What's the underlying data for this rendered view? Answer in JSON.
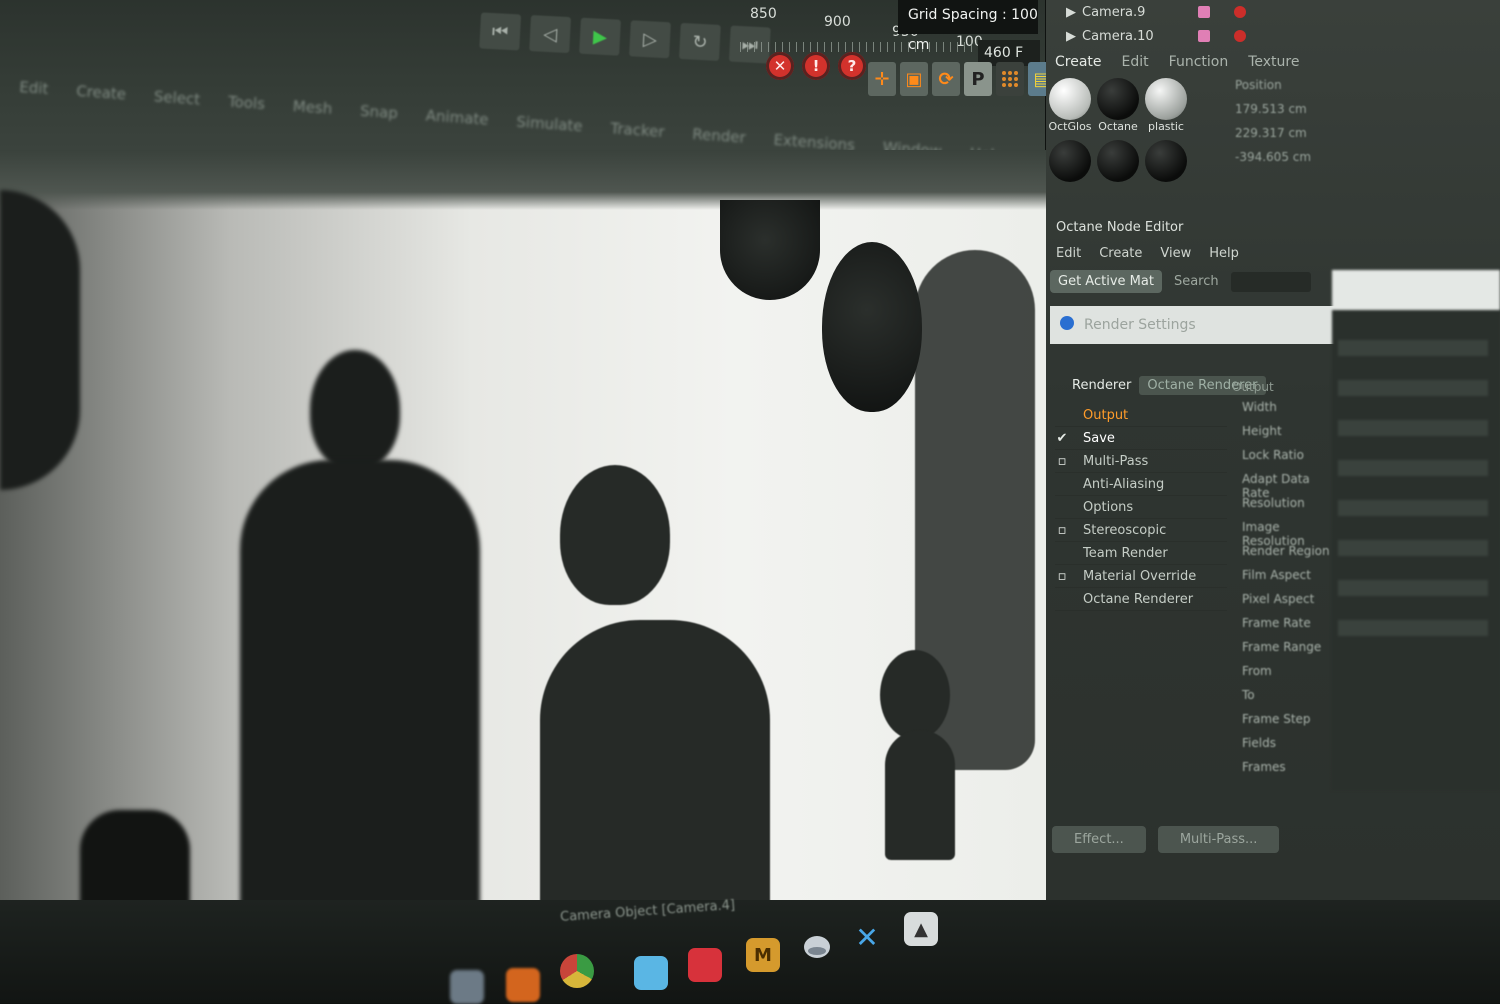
{
  "top_bar": {
    "menu_items": [
      "Edit",
      "Create",
      "Select",
      "Tools",
      "Mesh",
      "Snap",
      "Animate",
      "Simulate",
      "Tracker",
      "Render",
      "Extensions",
      "Window",
      "Help"
    ],
    "ruler_ticks": [
      "850",
      "900",
      "950",
      "100"
    ],
    "grid_spacing": "Grid Spacing : 100 cm",
    "frame_field": "460 F",
    "transport": {
      "to_start": "⏮",
      "prev_key": "◁",
      "play": "▶",
      "next_key": "▷",
      "loop": "↻",
      "to_end": "⏭"
    },
    "record_buttons": [
      "✕",
      "!",
      "?"
    ],
    "tool_buttons": {
      "move": "✛",
      "scale": "▣",
      "rotate": "⟳",
      "p": "P"
    }
  },
  "viewport": {
    "status_text": "Camera Object [Camera.4]"
  },
  "cameras_panel": {
    "items": [
      "Camera.9",
      "Camera.10"
    ]
  },
  "material_manager": {
    "tabs": [
      "Create",
      "Edit",
      "Function",
      "Texture"
    ],
    "materials": [
      {
        "name": "OctGlos",
        "style": "light"
      },
      {
        "name": "Octane",
        "style": "dark"
      },
      {
        "name": "plastic",
        "style": "light"
      },
      {
        "name": "",
        "style": "dark"
      },
      {
        "name": "",
        "style": "dark"
      },
      {
        "name": "",
        "style": "dark"
      }
    ]
  },
  "attributes_panel": {
    "header": "Position",
    "values": [
      "179.513 cm",
      "229.317 cm",
      "-394.605 cm"
    ]
  },
  "node_editor": {
    "title": "Octane Node Editor",
    "menu": [
      "Edit",
      "Create",
      "View",
      "Help"
    ],
    "get_active_button": "Get Active Mat",
    "search_label": "Search"
  },
  "render_settings": {
    "title": "Render Settings",
    "renderer_label": "Renderer",
    "renderer_value": "Octane Renderer",
    "output_header": "Output",
    "items": [
      {
        "label": "Output",
        "check": ""
      },
      {
        "label": "Save",
        "check": "✔"
      },
      {
        "label": "Multi-Pass",
        "check": "▫"
      },
      {
        "label": "Anti-Aliasing",
        "check": ""
      },
      {
        "label": "Options",
        "check": ""
      },
      {
        "label": "Stereoscopic",
        "check": "▫"
      },
      {
        "label": "Team Render",
        "check": ""
      },
      {
        "label": "Material Override",
        "check": "▫"
      },
      {
        "label": "Octane Renderer",
        "check": ""
      }
    ],
    "params": [
      "Width",
      "Height",
      "Lock Ratio",
      "Adapt Data Rate",
      "Resolution",
      "Image Resolution",
      "Render Region",
      "Film Aspect",
      "Pixel Aspect",
      "Frame Rate",
      "Frame Range",
      "From",
      "To",
      "Frame Step",
      "Fields",
      "Frames"
    ],
    "buttons": [
      "Effect...",
      "Multi-Pass..."
    ]
  },
  "dock": {
    "apps": [
      "",
      "",
      "",
      "",
      "",
      "M",
      "",
      "✕",
      "▲"
    ]
  },
  "colors": {
    "accent_orange": "#ff9c2a",
    "record_red": "#d3322c",
    "play_green": "#3fc64a",
    "panel_bg": "#2f3531"
  }
}
